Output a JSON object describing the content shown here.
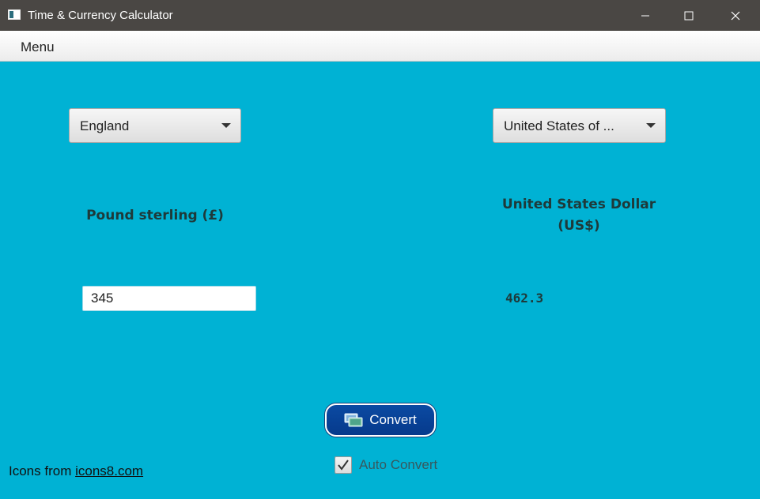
{
  "window": {
    "title": "Time & Currency Calculator"
  },
  "menubar": {
    "menu_label": "Menu"
  },
  "from": {
    "country": "England",
    "currency_name": "Pound sterling (£)",
    "amount": "345"
  },
  "to": {
    "country": "United States of ...",
    "currency_name_line1": "United States Dollar",
    "currency_name_line2": "(US$)",
    "result": "462.3"
  },
  "actions": {
    "convert_label": "Convert",
    "auto_convert_label": "Auto Convert",
    "auto_convert_checked": true
  },
  "credit": {
    "prefix": "Icons from",
    "link_text": "icons8.com"
  },
  "colors": {
    "background": "#00b2d4",
    "titlebar": "#4a4744",
    "convert_button": "#0b4aa2"
  }
}
